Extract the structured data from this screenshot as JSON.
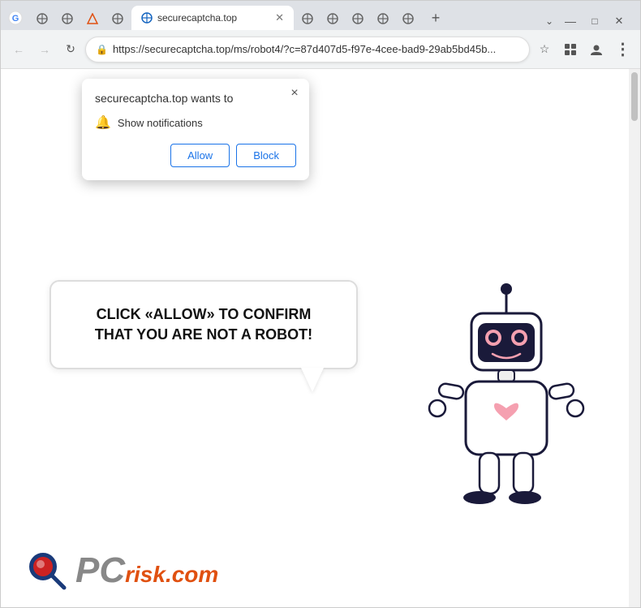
{
  "browser": {
    "tabs": [
      {
        "favicon": "globe",
        "title": "securecaptcha.top",
        "active": true
      },
      {
        "favicon": "globe",
        "title": ""
      },
      {
        "favicon": "globe",
        "title": ""
      },
      {
        "favicon": "globe",
        "title": ""
      },
      {
        "favicon": "star",
        "title": ""
      },
      {
        "favicon": "globe",
        "title": ""
      },
      {
        "favicon": "globe",
        "title": ""
      },
      {
        "favicon": "globe",
        "title": ""
      },
      {
        "favicon": "globe",
        "title": ""
      },
      {
        "favicon": "globe",
        "title": ""
      }
    ],
    "new_tab_label": "+",
    "url": "https://securecaptcha.top/ms/robot4/?c=87d407d5-f97e-4cee-bad9-29ab5bd45b...",
    "lock_icon": "🔒",
    "back_disabled": false,
    "forward_disabled": true,
    "reload_icon": "↻"
  },
  "notification_popup": {
    "title": "securecaptcha.top wants to",
    "permission_text": "Show notifications",
    "allow_label": "Allow",
    "block_label": "Block",
    "close_icon": "×"
  },
  "page": {
    "speech_bubble_text": "CLICK «ALLOW» TO CONFIRM THAT YOU ARE NOT A ROBOT!"
  },
  "pcrisk": {
    "pc_text": "PC",
    "risk_text": "risk",
    "dotcom_text": ".com"
  },
  "icons": {
    "bell": "🔔",
    "lock": "🔒",
    "star": "☆",
    "menu": "⋮",
    "back": "←",
    "forward": "→",
    "reload": "↻",
    "profile": "👤",
    "extensions": "🧩",
    "minimize": "—",
    "maximize": "□",
    "close": "✕"
  }
}
